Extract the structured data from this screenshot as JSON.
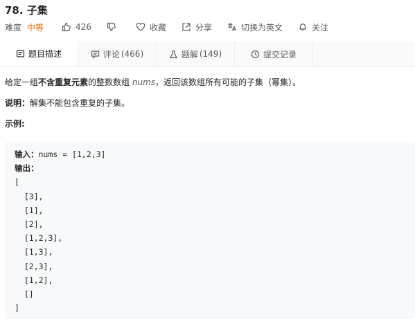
{
  "problem": {
    "title": "78. 子集",
    "difficulty_label": "难度",
    "difficulty": "中等",
    "likes": "426"
  },
  "actions": {
    "favorite": "收藏",
    "share": "分享",
    "switch_lang": "切换为英文",
    "follow": "关注"
  },
  "tabs": [
    {
      "label": "题目描述",
      "count": ""
    },
    {
      "label": "评论",
      "count": "(466)"
    },
    {
      "label": "题解",
      "count": "(149)"
    },
    {
      "label": "提交记录",
      "count": ""
    }
  ],
  "description": {
    "p1_prefix": "给定一组",
    "p1_bold": "不含重复元素",
    "p1_mid": "的整数数组 ",
    "p1_var": "nums",
    "p1_suffix": "，返回该数组所有可能的子集（幂集）。",
    "note_label": "说明：",
    "note_text": "解集不能包含重复的子集。",
    "example_label": "示例:"
  },
  "example": {
    "input_label": "输入：",
    "input_value": "nums = [1,2,3]",
    "output_label": "输出：",
    "output_lines": [
      "[",
      "  [3],",
      "  [1],",
      "  [2],",
      "  [1,2,3],",
      "  [1,3],",
      "  [2,3],",
      "  [1,2],",
      "  []",
      "]"
    ]
  },
  "colors": {
    "difficulty": "#ef6c00",
    "tab_bar": "#fafafa",
    "code_bg": "#f7f9fa"
  }
}
